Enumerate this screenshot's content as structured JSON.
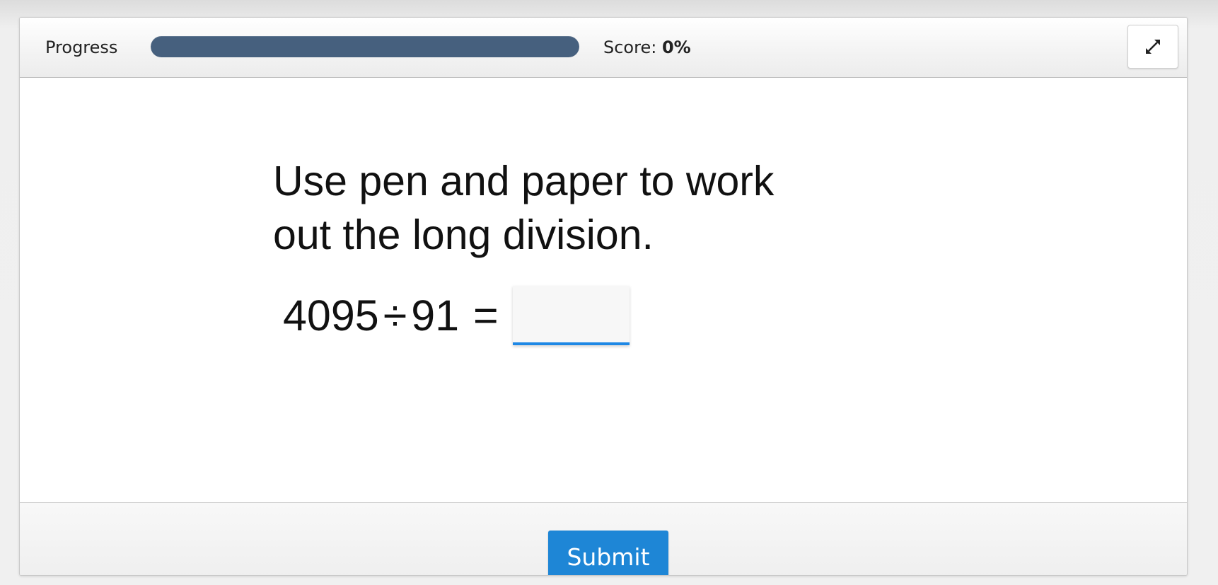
{
  "header": {
    "progress_label": "Progress",
    "progress_fraction": 1.0,
    "progress_color": "#46607e",
    "score_label": "Score:",
    "score_value": "0%",
    "fullscreen_icon": "expand-icon"
  },
  "question": {
    "instruction_line1": "Use pen and paper to work",
    "instruction_line2": "out the long division.",
    "dividend": "4095",
    "operator": "÷",
    "divisor": "91",
    "equals": "=",
    "answer_value": "",
    "answer_underline_color": "#1e88e5"
  },
  "footer": {
    "submit_label": "Submit",
    "submit_color": "#1e86d6"
  }
}
